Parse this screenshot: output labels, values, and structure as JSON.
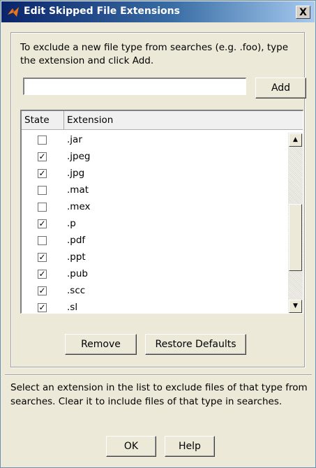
{
  "window": {
    "title": "Edit Skipped File Extensions",
    "close_label": "X"
  },
  "instructions": "To exclude a new file type from searches (e.g. .foo), type the extension and click Add.",
  "input": {
    "value": "",
    "placeholder": ""
  },
  "add_label": "Add",
  "table": {
    "headers": {
      "state": "State",
      "extension": "Extension"
    },
    "rows": [
      {
        "ext": ".jar",
        "checked": false
      },
      {
        "ext": ".jpeg",
        "checked": true
      },
      {
        "ext": ".jpg",
        "checked": true
      },
      {
        "ext": ".mat",
        "checked": false
      },
      {
        "ext": ".mex",
        "checked": false
      },
      {
        "ext": ".p",
        "checked": true
      },
      {
        "ext": ".pdf",
        "checked": false
      },
      {
        "ext": ".ppt",
        "checked": true
      },
      {
        "ext": ".pub",
        "checked": true
      },
      {
        "ext": ".scc",
        "checked": true
      },
      {
        "ext": ".sl",
        "checked": true
      }
    ]
  },
  "buttons": {
    "remove": "Remove",
    "restore": "Restore Defaults",
    "ok": "OK",
    "help": "Help"
  },
  "help_text": "Select an extension in the list to exclude files of that type from searches. Clear it to include files of that type in searches.",
  "colors": {
    "title_bar": "#0a246a",
    "window_bg": "#ece9d8",
    "icon_accent": "#e8761a"
  }
}
